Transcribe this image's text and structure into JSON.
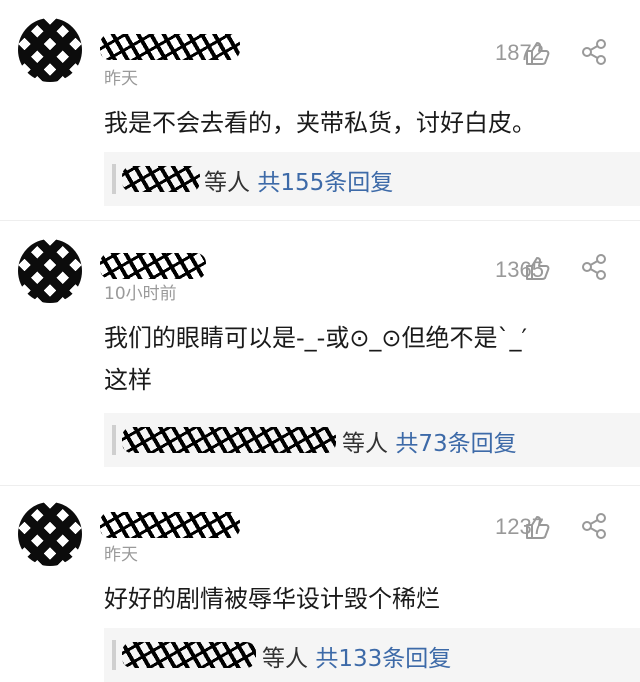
{
  "comments": [
    {
      "time": "昨天",
      "likes": "1872",
      "text_lines": [
        "我是不会去看的，夹带私货，讨好白皮。"
      ],
      "reply_suffix": "等人",
      "reply_count": "共155条回复"
    },
    {
      "time": "10小时前",
      "likes": "1365",
      "text_lines": [
        "我们的眼睛可以是-_-或⊙_⊙但绝不是`_′",
        "这样"
      ],
      "reply_suffix": "等人",
      "reply_count": "共73条回复"
    },
    {
      "time": "昨天",
      "likes": "1237",
      "text_lines": [
        "好好的剧情被辱华设计毁个稀烂"
      ],
      "reply_suffix": "等人",
      "reply_count": "共133条回复"
    }
  ],
  "icons": {
    "like": "thumbs-up-icon",
    "share": "share-icon"
  },
  "colors": {
    "link": "#3d6aa8",
    "muted": "#999999"
  }
}
